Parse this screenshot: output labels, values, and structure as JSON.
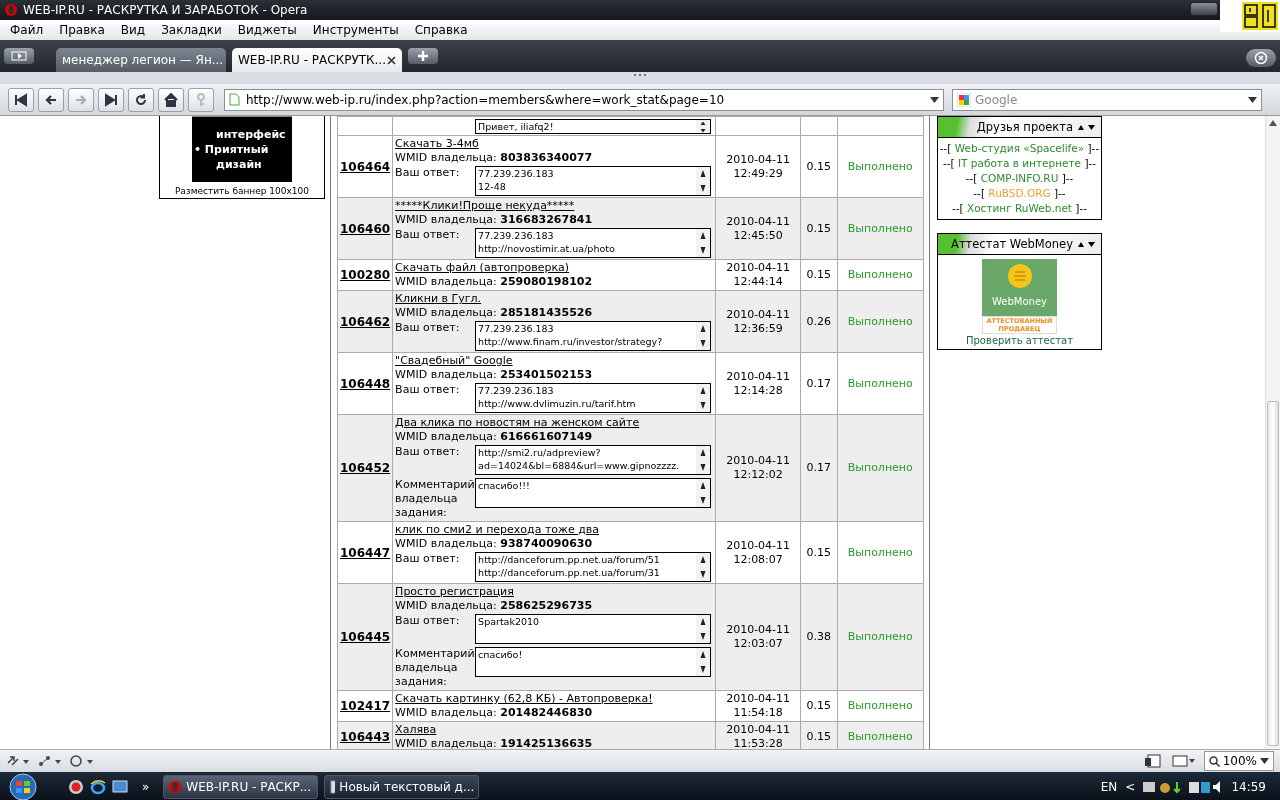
{
  "window": {
    "title": "WEB-IP.RU - РАСКРУТКА И ЗАРАБОТОК - Opera"
  },
  "menu": [
    "Файл",
    "Правка",
    "Вид",
    "Закладки",
    "Виджеты",
    "Инструменты",
    "Справка"
  ],
  "tabs": [
    {
      "label": "менеджер легион — Ян...",
      "selected": false
    },
    {
      "label": "WEB-IP.RU - РАСКРУТК...",
      "selected": true
    }
  ],
  "address": {
    "value": "http://www.web-ip.ru/index.php?action=members&where=work_stat&page=10"
  },
  "search": {
    "placeholder": "Google"
  },
  "banner": {
    "lines": [
      "интерфейс",
      "• Приятный",
      "дизайн"
    ],
    "caption": "Разместить баннер 100x100"
  },
  "table": {
    "top_answer": "Привет, iliafq2!",
    "rows": [
      {
        "id": "106464",
        "title": "Скачать 3-4мб",
        "wmid_label": "WMID владельца:",
        "wmid": "803836340077",
        "answer_label": "Ваш ответ:",
        "answer": [
          "77.239.236.183",
          "12-48"
        ],
        "date": "2010-04-11",
        "time": "12:49:29",
        "price": "0.15",
        "status": "Выполнено"
      },
      {
        "id": "106460",
        "title": "*****Клики!Проще некуда*****",
        "wmid_label": "WMID владельца:",
        "wmid": "316683267841",
        "answer_label": "Ваш ответ:",
        "answer": [
          "77.239.236.183",
          "http://novostimir.at.ua/photo"
        ],
        "date": "2010-04-11",
        "time": "12:45:50",
        "price": "0.15",
        "status": "Выполнено"
      },
      {
        "id": "100280",
        "title": "Скачать файл (автопроверка)",
        "wmid_label": "WMID владельца:",
        "wmid": "259080198102",
        "date": "2010-04-11",
        "time": "12:44:14",
        "price": "0.15",
        "status": "Выполнено"
      },
      {
        "id": "106462",
        "title": "Кликни в Гугл.",
        "wmid_label": "WMID владельца:",
        "wmid": "285181435526",
        "answer_label": "Ваш ответ:",
        "answer": [
          " 77.239.236.183",
          "http://www.finam.ru/investor/strategy?"
        ],
        "date": "2010-04-11",
        "time": "12:36:59",
        "price": "0.26",
        "status": "Выполнено"
      },
      {
        "id": "106448",
        "title": "\"Свадебный\" Google",
        "wmid_label": "WMID владельца:",
        "wmid": "253401502153",
        "answer_label": "Ваш ответ:",
        "answer": [
          "77.239.236.183",
          "http://www.dvlimuzin.ru/tarif.htm"
        ],
        "date": "2010-04-11",
        "time": "12:14:28",
        "price": "0.17",
        "status": "Выполнено"
      },
      {
        "id": "106452",
        "title": "Два клика по новостям на женском сайте",
        "wmid_label": "WMID владельца:",
        "wmid": "616661607149",
        "answer_label": "Ваш ответ:",
        "answer": [
          "http://smi2.ru/adpreview?",
          "ad=14024&bl=6884&url=www.gipnozzzz."
        ],
        "comment_label": "Комментарий владельца задания:",
        "comment": "спасибо!!!",
        "date": "2010-04-11",
        "time": "12:12:02",
        "price": "0.17",
        "status": "Выполнено"
      },
      {
        "id": "106447",
        "title": "клик по сми2 и перехода тоже два",
        "wmid_label": "WMID владельца:",
        "wmid": "938740090630",
        "answer_label": "Ваш ответ:",
        "answer": [
          "http://danceforum.pp.net.ua/forum/51",
          "http://danceforum.pp.net.ua/forum/31"
        ],
        "date": "2010-04-11",
        "time": "12:08:07",
        "price": "0.15",
        "status": "Выполнено"
      },
      {
        "id": "106445",
        "title": "Просто регистрация",
        "wmid_label": "WMID владельца:",
        "wmid": "258625296735",
        "answer_label": "Ваш ответ:",
        "answer": [
          " Spartak2010"
        ],
        "comment_label": "Комментарий владельца задания:",
        "comment": "спасибо!",
        "date": "2010-04-11",
        "time": "12:03:07",
        "price": "0.38",
        "status": "Выполнено"
      },
      {
        "id": "102417",
        "title": "Скачать картинку (62,8 КБ) - Автопроверка!",
        "wmid_label": "WMID владельца:",
        "wmid": "201482446830",
        "date": "2010-04-11",
        "time": "11:54:18",
        "price": "0.15",
        "status": "Выполнено"
      },
      {
        "id": "106443",
        "title": "Халява",
        "wmid_label": "WMID владельца:",
        "wmid": "191425136635",
        "date": "2010-04-11",
        "time": "11:53:28",
        "price": "0.15",
        "status": "Выполнено"
      }
    ]
  },
  "friends": {
    "title": "Друзья проекта",
    "links": [
      {
        "prefix": "--[",
        "text": "Web-студия «Spacelife»",
        "suffix": "]--",
        "color": "#2e8b2e"
      },
      {
        "prefix": "--[",
        "text": "IT работа в интернете",
        "suffix": "]--",
        "color": "#2e8b2e"
      },
      {
        "prefix": "--[",
        "text": "COMP-INFO.RU",
        "suffix": "]--",
        "color": "#2e8b2e"
      },
      {
        "prefix": "--[",
        "text": "RuBSD.ORG",
        "suffix": "]--",
        "color": "#f0a030"
      },
      {
        "prefix": "--[",
        "text": "Хостинг RuWeb.net",
        "suffix": "]--",
        "color": "#2e8b2e"
      }
    ]
  },
  "attestat": {
    "title": "Аттестат WebMoney",
    "logo": "WebMoney",
    "badge": "АТТЕСТОВАННЫЙ ПРОДАВЕЦ",
    "link": "Проверить аттестат"
  },
  "status_bar": {
    "zoom": "100%"
  },
  "taskbar": {
    "more": "»",
    "tasks": [
      {
        "label": "WEB-IP.RU - РАСКР...",
        "selected": true
      },
      {
        "label": "Новый текстовый д...",
        "selected": false
      }
    ],
    "lang": "EN",
    "tray_arrow": "<",
    "clock": "14:59"
  }
}
